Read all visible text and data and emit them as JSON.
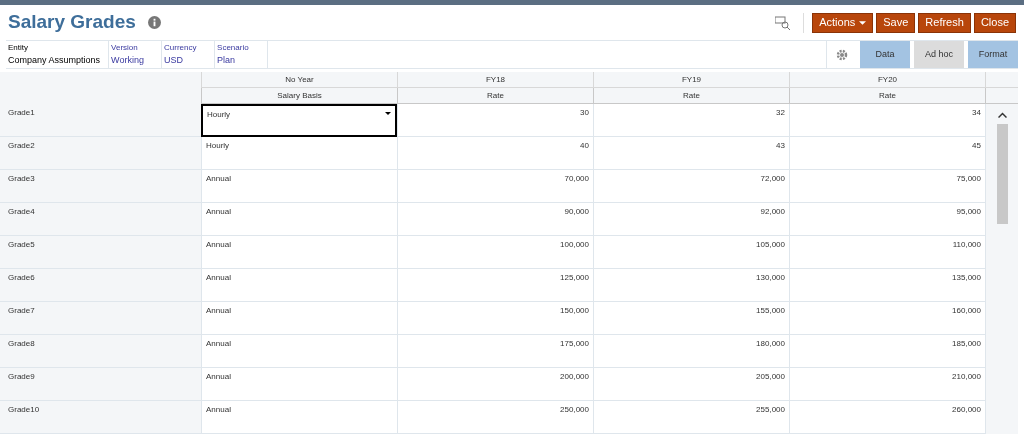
{
  "title": "Salary Grades",
  "actions": [
    {
      "label": "Actions",
      "kind": "menu"
    },
    {
      "label": "Save",
      "kind": "button"
    },
    {
      "label": "Refresh",
      "kind": "button"
    },
    {
      "label": "Close",
      "kind": "button"
    }
  ],
  "pov": [
    {
      "label": "Entity",
      "value": "Company Assumptions",
      "kind": "fixed"
    },
    {
      "label": "Version",
      "value": "Working",
      "kind": "link"
    },
    {
      "label": "Currency",
      "value": "USD",
      "kind": "link"
    },
    {
      "label": "Scenario",
      "value": "Plan",
      "kind": "link"
    }
  ],
  "modes": [
    {
      "label": "Data",
      "selected": true
    },
    {
      "label": "Ad hoc",
      "selected": false
    },
    {
      "label": "Format",
      "selected": true
    }
  ],
  "columns": [
    {
      "period": "No Year",
      "measure": "Salary Basis"
    },
    {
      "period": "FY18",
      "measure": "Rate"
    },
    {
      "period": "FY19",
      "measure": "Rate"
    },
    {
      "period": "FY20",
      "measure": "Rate"
    }
  ],
  "rows": [
    {
      "grade": "Grade1",
      "cells": [
        {
          "value": "Hourly",
          "selected": true
        },
        {
          "value": "30",
          "selected": false
        },
        {
          "value": "32",
          "selected": false
        },
        {
          "value": "34",
          "selected": false
        }
      ]
    },
    {
      "grade": "Grade2",
      "cells": [
        {
          "value": "Hourly",
          "selected": false
        },
        {
          "value": "40",
          "selected": false
        },
        {
          "value": "43",
          "selected": false
        },
        {
          "value": "45",
          "selected": false
        }
      ]
    },
    {
      "grade": "Grade3",
      "cells": [
        {
          "value": "Annual",
          "selected": false
        },
        {
          "value": "70,000",
          "selected": false
        },
        {
          "value": "72,000",
          "selected": false
        },
        {
          "value": "75,000",
          "selected": false
        }
      ]
    },
    {
      "grade": "Grade4",
      "cells": [
        {
          "value": "Annual",
          "selected": false
        },
        {
          "value": "90,000",
          "selected": false
        },
        {
          "value": "92,000",
          "selected": false
        },
        {
          "value": "95,000",
          "selected": false
        }
      ]
    },
    {
      "grade": "Grade5",
      "cells": [
        {
          "value": "Annual",
          "selected": false
        },
        {
          "value": "100,000",
          "selected": false
        },
        {
          "value": "105,000",
          "selected": false
        },
        {
          "value": "110,000",
          "selected": false
        }
      ]
    },
    {
      "grade": "Grade6",
      "cells": [
        {
          "value": "Annual",
          "selected": false
        },
        {
          "value": "125,000",
          "selected": false
        },
        {
          "value": "130,000",
          "selected": false
        },
        {
          "value": "135,000",
          "selected": false
        }
      ]
    },
    {
      "grade": "Grade7",
      "cells": [
        {
          "value": "Annual",
          "selected": false
        },
        {
          "value": "150,000",
          "selected": false
        },
        {
          "value": "155,000",
          "selected": false
        },
        {
          "value": "160,000",
          "selected": false
        }
      ]
    },
    {
      "grade": "Grade8",
      "cells": [
        {
          "value": "Annual",
          "selected": false
        },
        {
          "value": "175,000",
          "selected": false
        },
        {
          "value": "180,000",
          "selected": false
        },
        {
          "value": "185,000",
          "selected": false
        }
      ]
    },
    {
      "grade": "Grade9",
      "cells": [
        {
          "value": "Annual",
          "selected": false
        },
        {
          "value": "200,000",
          "selected": false
        },
        {
          "value": "205,000",
          "selected": false
        },
        {
          "value": "210,000",
          "selected": false
        }
      ]
    },
    {
      "grade": "Grade10",
      "cells": [
        {
          "value": "Annual",
          "selected": false
        },
        {
          "value": "250,000",
          "selected": false
        },
        {
          "value": "255,000",
          "selected": false
        },
        {
          "value": "260,000",
          "selected": false
        }
      ]
    }
  ]
}
